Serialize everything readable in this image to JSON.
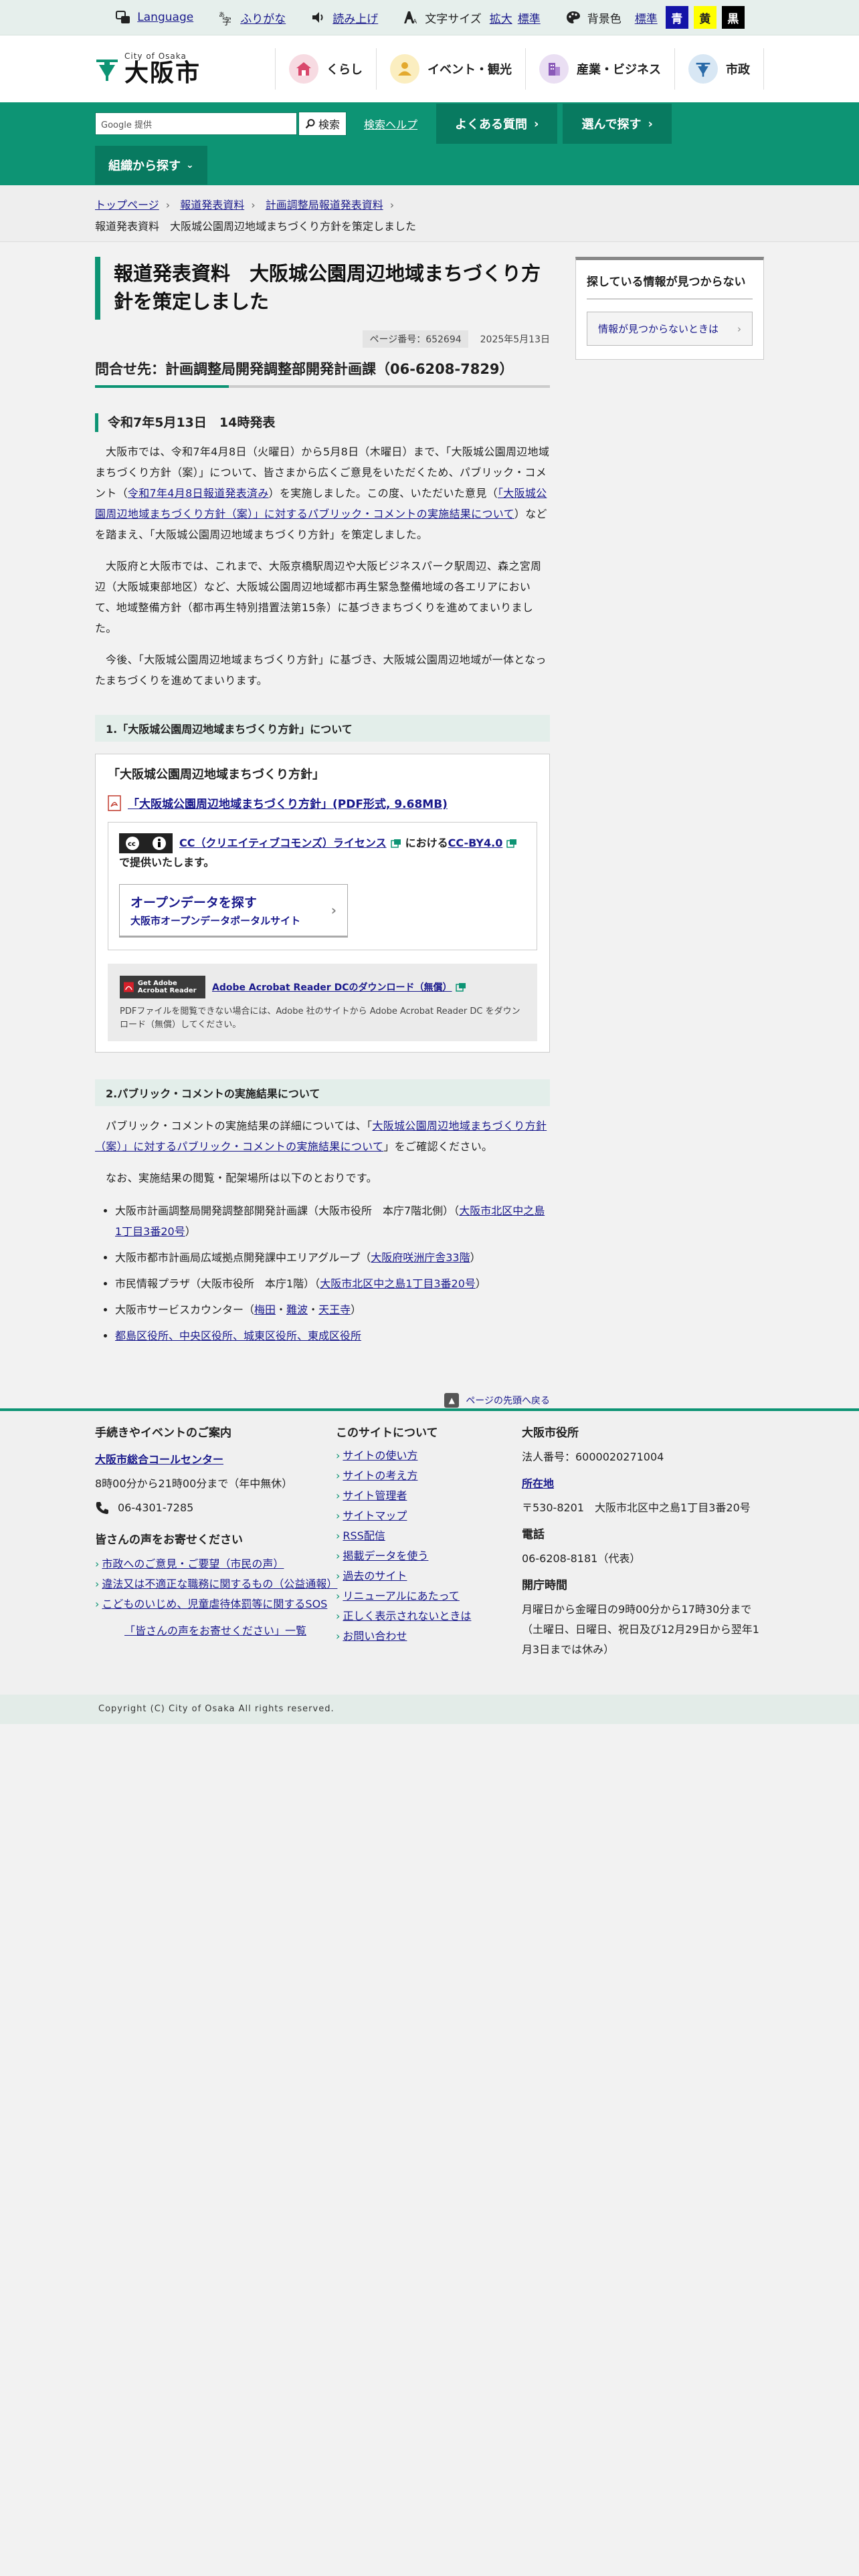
{
  "util": {
    "language": "Language",
    "furigana": "ふりがな",
    "read_aloud": "読み上げ",
    "font_size_label": "文字サイズ",
    "font_large": "拡大",
    "font_standard": "標準",
    "bg_label": "背景色",
    "bg_standard": "標準",
    "bg_blue": "青",
    "bg_yellow": "黄",
    "bg_black": "黒"
  },
  "header": {
    "logo_sub": "City of Osaka",
    "logo_main": "大阪市",
    "nav": [
      "くらし",
      "イベント・観光",
      "産業・ビジネス",
      "市政"
    ]
  },
  "gbar": {
    "search_placeholder": "Google 提供",
    "search_button": "検索",
    "help": "検索ヘルプ",
    "faq": "よくある質問",
    "choose": "選んで探す",
    "org": "組織から探す"
  },
  "breadcrumb": [
    "トップページ",
    "報道発表資料",
    "計画調整局報道発表資料",
    "報道発表資料　大阪城公園周辺地域まちづくり方針を策定しました"
  ],
  "main": {
    "title": "報道発表資料　大阪城公園周辺地域まちづくり方針を策定しました",
    "page_no": "ページ番号：652694",
    "date": "2025年5月13日",
    "contact": "問合せ先：計画調整局開発調整部開発計画課（06-6208-7829）",
    "announce": "令和7年5月13日　14時発表",
    "p1_a": "大阪市では、令和7年4月8日（火曜日）から5月8日（木曜日）まで、「大阪城公園周辺地域まちづくり方針（案）」について、皆さまから広くご意見をいただくため、パブリック・コメント（",
    "p1_link1": "令和7年4月8日報道発表済み",
    "p1_b": "）を実施しました。この度、いただいた意見（",
    "p1_link2": "「大阪城公園周辺地域まちづくり方針（案）」に対するパブリック・コメントの実施結果について",
    "p1_c": "）などを踏まえ、「大阪城公園周辺地域まちづくり方針」を策定しました。",
    "p2": "大阪府と大阪市では、これまで、大阪京橋駅周辺や大阪ビジネスパーク駅周辺、森之宮周辺（大阪城東部地区）など、大阪城公園周辺地域都市再生緊急整備地域の各エリアにおいて、地域整備方針（都市再生特別措置法第15条）に基づきまちづくりを進めてまいりました。",
    "p3": "今後、「大阪城公園周辺地域まちづくり方針」に基づき、大阪城公園周辺地域が一体となったまちづくりを進めてまいります。",
    "sec1": "1.「大阪城公園周辺地域まちづくり方針」について",
    "box_title": "「大阪城公園周辺地域まちづくり方針」",
    "pdf_link": "「大阪城公園周辺地域まちづくり方針」(PDF形式, 9.68MB)",
    "cc_link": "CC（クリエイティブコモンズ）ライセンス",
    "cc_mid": "における",
    "cc_by": "CC-BY4.0",
    "cc_end": "で提供いたします。",
    "od_main": "オープンデータを探す",
    "od_sub": "大阪市オープンデータポータルサイト",
    "adobe_badge": "Get Adobe Acrobat Reader",
    "adobe_link": "Adobe Acrobat Reader DCのダウンロード（無償）",
    "adobe_note": "PDFファイルを閲覧できない場合には、Adobe 社のサイトから Adobe Acrobat Reader DC をダウンロード（無償）してください。",
    "sec2": "2.パブリック・コメントの実施結果について",
    "p4_a": "パブリック・コメントの実施結果の詳細については、「",
    "p4_link": "大阪城公園周辺地域まちづくり方針（案）」に対するパブリック・コメントの実施結果について",
    "p4_b": "」をご確認ください。",
    "p5": "なお、実施結果の閲覧・配架場所は以下のとおりです。",
    "li1_a": "大阪市計画調整局開発調整部開発計画課（大阪市役所　本庁7階北側）（",
    "li1_link": "大阪市北区中之島1丁目3番20号",
    "li1_b": "）",
    "li2_a": "大阪市都市計画局広域拠点開発課中エリアグループ（",
    "li2_link": "大阪府咲洲庁舎33階",
    "li2_b": "）",
    "li3_a": "市民情報プラザ（大阪市役所　本庁1階）（",
    "li3_link": "大阪市北区中之島1丁目3番20号",
    "li3_b": "）",
    "li4_a": "大阪市サービスカウンター（",
    "li4_l1": "梅田",
    "li4_dot": "・",
    "li4_l2": "難波",
    "li4_l3": "天王寺",
    "li4_b": "）",
    "li5_link": "都島区役所、中央区役所、城東区役所、東成区役所",
    "to_top": "ページの先頭へ戻る"
  },
  "aside": {
    "title": "探している情報が見つからない",
    "button": "情報が見つからないときは"
  },
  "footer": {
    "col1_h": "手続きやイベントのご案内",
    "center_link": "大阪市総合コールセンター",
    "hours": "8時00分から21時00分まで（年中無休）",
    "tel": "06-4301-7285",
    "voice_h": "皆さんの声をお寄せください",
    "voice1": "市政へのご意見・ご要望（市民の声）",
    "voice2": "違法又は不適正な職務に関するもの（公益通報）",
    "voice3": "こどものいじめ、児童虐待体罰等に関するSOS",
    "voice_list": "「皆さんの声をお寄せください」一覧",
    "col2_h": "このサイトについて",
    "links": [
      "サイトの使い方",
      "サイトの考え方",
      "サイト管理者",
      "サイトマップ",
      "RSS配信",
      "掲載データを使う",
      "過去のサイト",
      "リニューアルにあたって",
      "正しく表示されないときは",
      "お問い合わせ"
    ],
    "col3_h": "大阪市役所",
    "corp_no": "法人番号：6000020271004",
    "loc_link": "所在地",
    "address": "〒530-8201　大阪市北区中之島1丁目3番20号",
    "tel_h": "電話",
    "tel_main": "06-6208-8181（代表）",
    "open_h": "開庁時間",
    "open1": "月曜日から金曜日の9時00分から17時30分まで",
    "open2": "（土曜日、日曜日、祝日及び12月29日から翌年1月3日までは休み）",
    "copyright": "Copyright (C) City of Osaka All rights reserved."
  },
  "colors": {
    "green": "#0d9474",
    "dark_green": "#087a60",
    "link": "#1a1a8c"
  }
}
